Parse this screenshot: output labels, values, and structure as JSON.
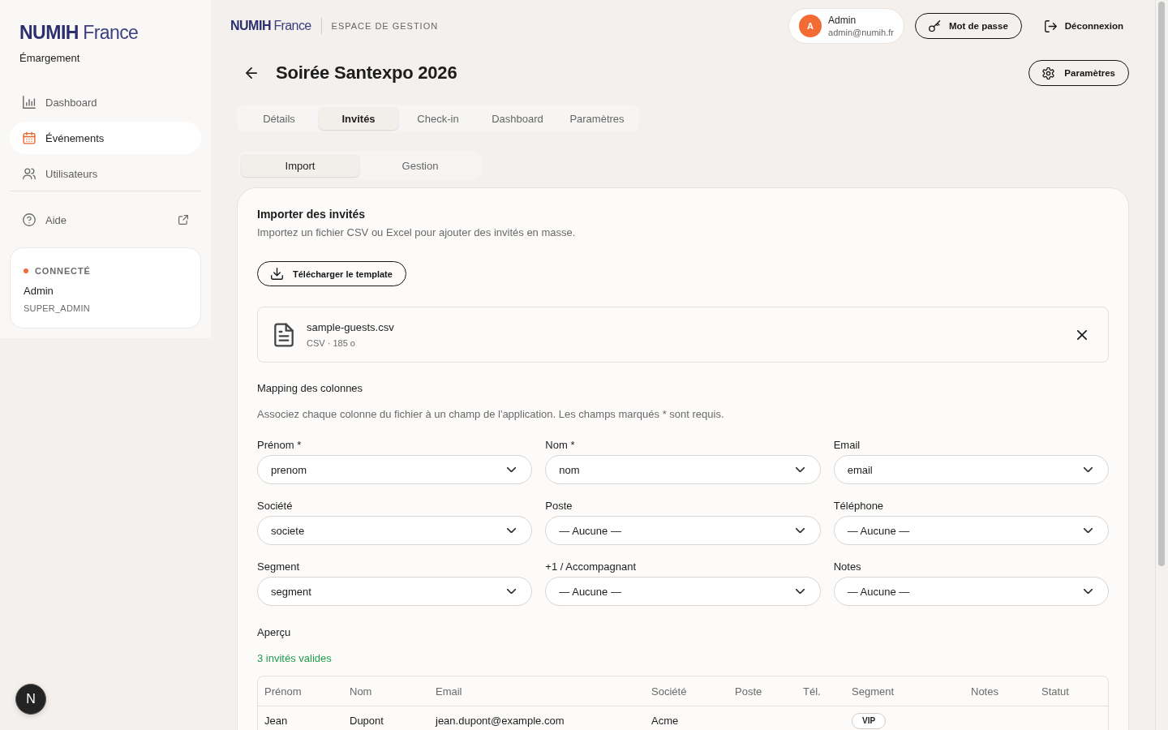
{
  "sidebar": {
    "logo": {
      "brand": "NUMIH",
      "suffix": "France"
    },
    "app_name": "Émargement",
    "nav": [
      {
        "label": "Dashboard",
        "selected": false
      },
      {
        "label": "Événements",
        "selected": true
      },
      {
        "label": "Utilisateurs",
        "selected": false
      }
    ],
    "help": {
      "label": "Aide"
    },
    "session": {
      "status": "CONNECTÉ",
      "name": "Admin",
      "role": "SUPER_ADMIN"
    }
  },
  "header": {
    "logo": {
      "brand": "NUMIH",
      "suffix": "France"
    },
    "section": "ESPACE DE GESTION",
    "user": {
      "initial": "A",
      "name": "Admin",
      "email": "admin@numih.fr"
    },
    "password_button": "Mot de passe",
    "logout_button": "Déconnexion"
  },
  "page": {
    "title": "Soirée Santexpo 2026",
    "settings_button": "Paramètres"
  },
  "tabs": [
    {
      "label": "Détails",
      "selected": false
    },
    {
      "label": "Invités",
      "selected": true
    },
    {
      "label": "Check-in",
      "selected": false
    },
    {
      "label": "Dashboard",
      "selected": false
    },
    {
      "label": "Paramètres",
      "selected": false
    }
  ],
  "subtabs": [
    {
      "label": "Import",
      "selected": true
    },
    {
      "label": "Gestion",
      "selected": false
    }
  ],
  "import_card": {
    "title": "Importer des invités",
    "description": "Importez un fichier CSV ou Excel pour ajouter des invités en masse.",
    "template_button": "Télécharger le template",
    "file": {
      "name": "sample-guests.csv",
      "meta": "CSV · 185 o"
    },
    "mapping": {
      "title": "Mapping des colonnes",
      "description": "Associez chaque colonne du fichier à un champ de l'application. Les champs marqués * sont requis.",
      "fields": [
        {
          "label": "Prénom *",
          "value": "prenom"
        },
        {
          "label": "Nom *",
          "value": "nom"
        },
        {
          "label": "Email",
          "value": "email"
        },
        {
          "label": "Société",
          "value": "societe"
        },
        {
          "label": "Poste",
          "value": "— Aucune —"
        },
        {
          "label": "Téléphone",
          "value": "— Aucune —"
        },
        {
          "label": "Segment",
          "value": "segment"
        },
        {
          "label": "+1 / Accompagnant",
          "value": "— Aucune —"
        },
        {
          "label": "Notes",
          "value": "— Aucune —"
        }
      ]
    },
    "preview": {
      "title": "Aperçu",
      "summary": "3 invités valides",
      "table": {
        "columns": [
          "Prénom",
          "Nom",
          "Email",
          "Société",
          "Poste",
          "Tél.",
          "Segment",
          "Notes",
          "Statut"
        ],
        "rows": [
          {
            "cells": [
              {
                "kind": "text",
                "text": "Jean"
              },
              {
                "kind": "text",
                "text": "Dupont"
              },
              {
                "kind": "text",
                "text": "jean.dupont@example.com"
              },
              {
                "kind": "text",
                "text": "Acme"
              },
              null,
              null,
              {
                "kind": "badge",
                "text": "VIP"
              },
              null,
              null
            ]
          }
        ]
      }
    }
  },
  "dev_indicator": {
    "label": "N"
  }
}
